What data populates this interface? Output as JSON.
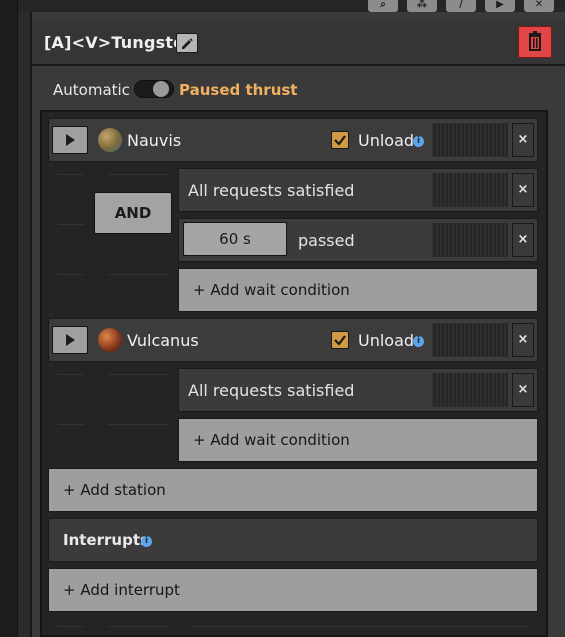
{
  "header": {
    "title": "[A]<V>Tungsten",
    "toolbar_glyphs": [
      "⌕",
      "⁂",
      "/",
      "▶",
      "✕"
    ]
  },
  "mode": {
    "label": "Automatic",
    "status": "Paused thrust"
  },
  "stations": [
    {
      "name": "Nauvis",
      "action": "Unload",
      "conditions": [
        {
          "text": "All requests satisfied"
        },
        {
          "time": "60 s",
          "text": "passed"
        }
      ],
      "connector": "AND",
      "add_wait": "+ Add wait condition"
    },
    {
      "name": "Vulcanus",
      "action": "Unload",
      "conditions": [
        {
          "text": "All requests satisfied"
        }
      ],
      "add_wait": "+ Add wait condition"
    }
  ],
  "add_station": "+ Add station",
  "interrupts": {
    "label": "Interrupts"
  },
  "add_interrupt": "+ Add interrupt",
  "colors": {
    "accent": "#f0b060",
    "delete": "#e04646",
    "checkbox": "#d19a43",
    "info": "#5fa6e8"
  }
}
